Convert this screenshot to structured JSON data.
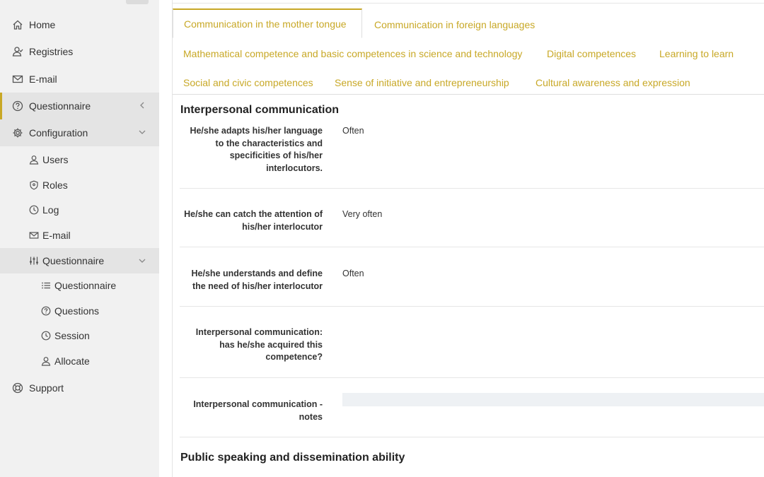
{
  "sidebar": {
    "items": [
      {
        "label": "Home",
        "icon": "home-icon"
      },
      {
        "label": "Registries",
        "icon": "user-group-icon"
      },
      {
        "label": "E-mail",
        "icon": "envelope-icon"
      },
      {
        "label": "Questionnaire",
        "icon": "question-circle-icon"
      },
      {
        "label": "Configuration",
        "icon": "gear-icon"
      },
      {
        "label": "Users",
        "icon": "user-icon"
      },
      {
        "label": "Roles",
        "icon": "shield-icon"
      },
      {
        "label": "Log",
        "icon": "clock-icon"
      },
      {
        "label": "E-mail",
        "icon": "envelope-icon"
      },
      {
        "label": "Questionnaire",
        "icon": "sliders-icon"
      },
      {
        "label": "Questionnaire",
        "icon": "list-icon"
      },
      {
        "label": "Questions",
        "icon": "question-circle-icon"
      },
      {
        "label": "Session",
        "icon": "clock-icon"
      },
      {
        "label": "Allocate",
        "icon": "user-icon"
      },
      {
        "label": "Support",
        "icon": "lifebuoy-icon"
      }
    ]
  },
  "tabs": [
    {
      "label": "Communication in the mother tongue",
      "active": true
    },
    {
      "label": "Communication in foreign languages"
    },
    {
      "label": "Mathematical competence and basic competences in science and technology"
    },
    {
      "label": "Digital competences"
    },
    {
      "label": "Learning to learn"
    },
    {
      "label": "Social and civic competences"
    },
    {
      "label": "Sense of initiative and entrepreneurship"
    },
    {
      "label": "Cultural awareness and expression"
    }
  ],
  "sections": [
    {
      "title": "Interpersonal communication",
      "rows": [
        {
          "question": "He/she adapts his/her language to the characteristics and specificities of his/her interlocutors.",
          "answer": "Often"
        },
        {
          "question": "He/she can catch the attention of his/her interlocutor",
          "answer": "Very often"
        },
        {
          "question": "He/she understands and define the need of his/her interlocutor",
          "answer": "Often"
        },
        {
          "question": "Interpersonal communication: has he/she acquired this competence?",
          "answer": ""
        },
        {
          "question": "Interpersonal communication - notes",
          "answer": ""
        }
      ]
    },
    {
      "title": "Public speaking and dissemination ability",
      "rows": []
    }
  ],
  "colors": {
    "accent": "#c8a826",
    "sidebar_bg": "#f1f1f1",
    "selected_bg": "#e4e4e4"
  }
}
